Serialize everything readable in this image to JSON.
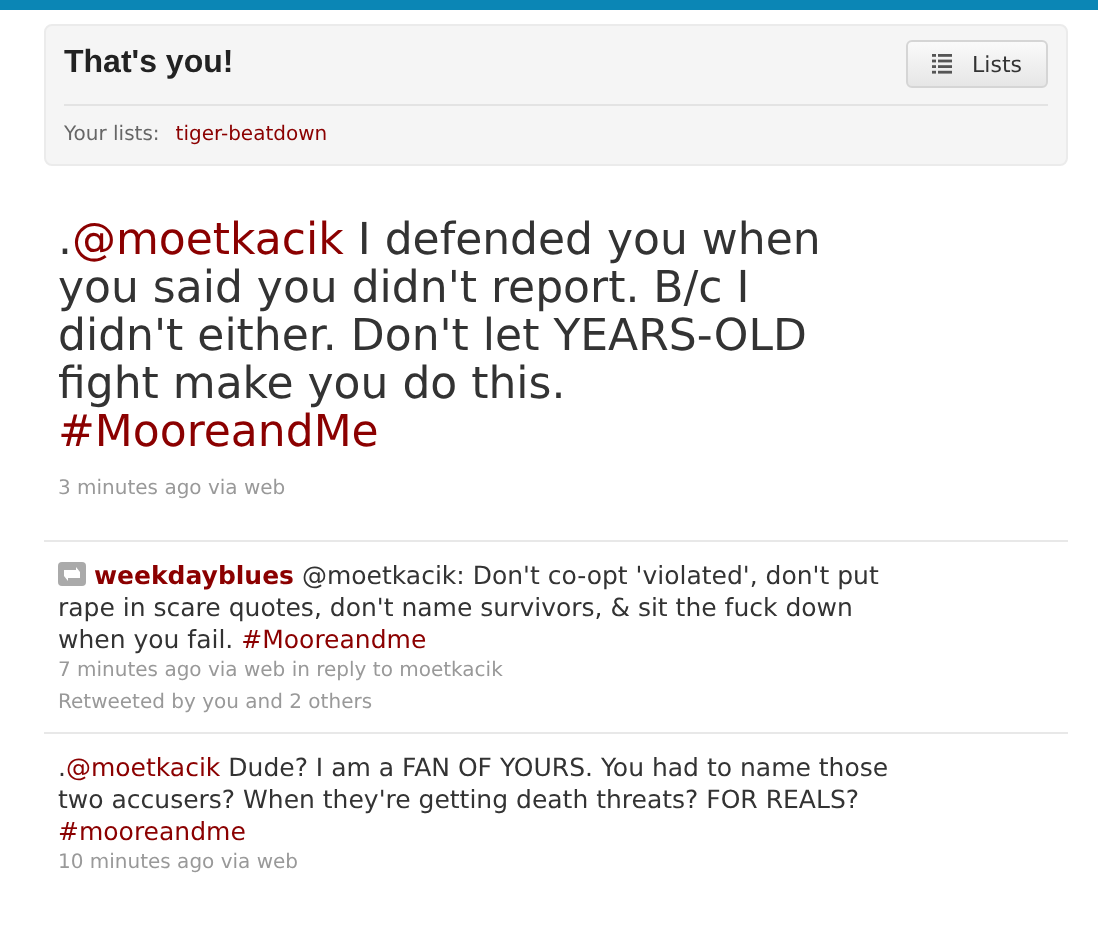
{
  "panel": {
    "title": "That's you!",
    "lists_button": "Lists",
    "your_lists_label": "Your lists:",
    "lists": [
      "tiger-beatdown"
    ]
  },
  "featured_tweet": {
    "segments": [
      {
        "kind": "text",
        "text": "."
      },
      {
        "kind": "mention",
        "text": "@moetkacik"
      },
      {
        "kind": "text",
        "text": " I defended you when you said you didn't report. B/c I didn't either. Don't let YEARS-OLD fight make you do this. "
      },
      {
        "kind": "hashtag",
        "text": "#MooreandMe"
      }
    ],
    "meta": "3 minutes ago via web"
  },
  "timeline": [
    {
      "retweet": true,
      "author": "weekdayblues",
      "segments": [
        {
          "kind": "text",
          "text": " @moetkacik: Don't co-opt 'violated', don't put rape in scare quotes, don't name survivors, & sit the fuck down when you fail. "
        },
        {
          "kind": "hashtag",
          "text": "#Mooreandme"
        }
      ],
      "meta": "7 minutes ago via web in reply to moetkacik",
      "retweeted_by": "Retweeted by you and 2 others"
    },
    {
      "retweet": false,
      "segments": [
        {
          "kind": "text",
          "text": "."
        },
        {
          "kind": "mention",
          "text": "@moetkacik"
        },
        {
          "kind": "text",
          "text": " Dude? I am a FAN OF YOURS. You had to name those two accusers? When they're getting death threats? FOR REALS? "
        },
        {
          "kind": "hashtag",
          "text": "#mooreandme"
        }
      ],
      "meta": "10 minutes ago via web"
    }
  ]
}
